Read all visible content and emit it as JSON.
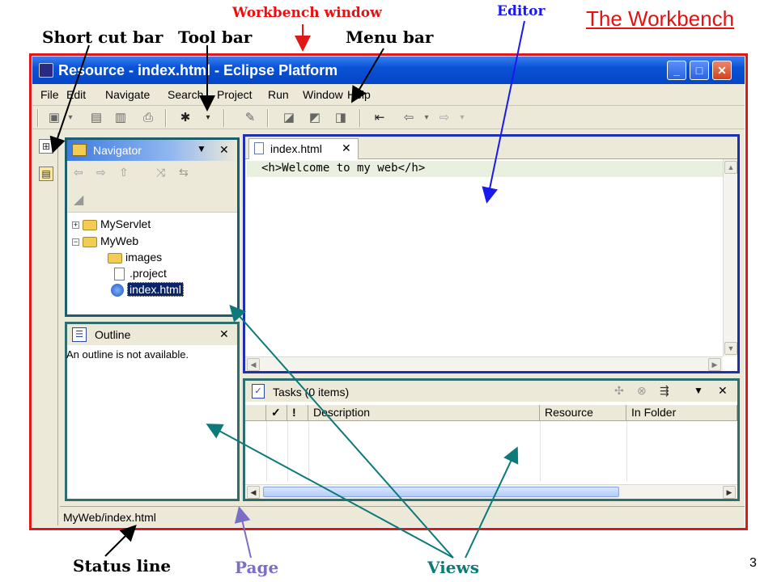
{
  "slide": {
    "title": "The Workbench",
    "page_number": "3",
    "annotations": {
      "workbench_window": "Workbench window",
      "editor": "Editor",
      "shortcut_bar": "Short cut bar",
      "tool_bar": "Tool bar",
      "menu_bar": "Menu bar",
      "status_line": "Status line",
      "page": "Page",
      "views": "Views"
    },
    "colors": {
      "title": "#e81010",
      "editor_annotation": "#1a1aee",
      "views_annotation": "#0c7a7a",
      "page_annotation": "#7a6fc4",
      "window_outline": "#e01818"
    }
  },
  "window": {
    "title": "Resource - index.html - Eclipse Platform",
    "controls": [
      "minimize",
      "maximize",
      "close"
    ]
  },
  "menu": {
    "items": [
      "File",
      "Edit",
      "Navigate",
      "Search",
      "Project",
      "Run",
      "Window",
      "Help"
    ]
  },
  "toolbar": {
    "icons": [
      "new-wizard-icon",
      "save-icon",
      "save-all-icon",
      "print-icon",
      "run-icon",
      "pin-icon",
      "back-edit-icon",
      "prev-annotation-icon",
      "next-annotation-icon",
      "last-edit-icon",
      "back-icon",
      "forward-icon"
    ]
  },
  "shortcut_bar": {
    "icons": [
      "open-perspective-icon",
      "resource-perspective-icon"
    ]
  },
  "navigator": {
    "title": "Navigator",
    "tree": [
      {
        "label": "MyServlet",
        "expander": "+"
      },
      {
        "label": "MyWeb",
        "expander": "−"
      },
      {
        "label": "images"
      },
      {
        "label": ".project"
      },
      {
        "label": "index.html"
      }
    ]
  },
  "outline": {
    "title": "Outline",
    "message": "An outline is not available."
  },
  "editor": {
    "tab": "index.html",
    "content": "<h>Welcome to my web</h>"
  },
  "tasks": {
    "title": "Tasks (0 items)",
    "columns": [
      "✓",
      "!",
      "Description",
      "Resource",
      "In Folder"
    ]
  },
  "status": {
    "text": "MyWeb/index.html"
  }
}
